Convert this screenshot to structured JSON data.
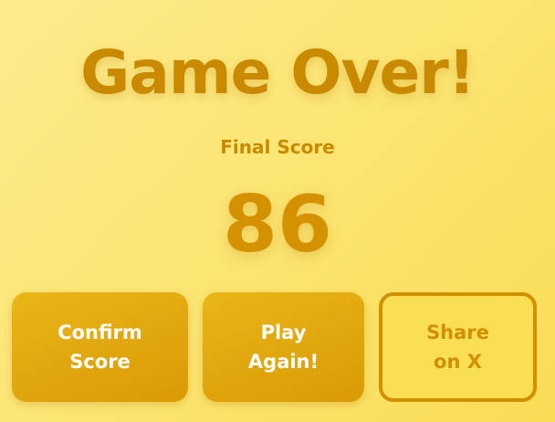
{
  "game_over": {
    "title": "Game Over!",
    "score_label": "Final Score",
    "score_value": "86"
  },
  "actions": {
    "confirm_label": "Confirm\nScore",
    "play_again_label": "Play\nAgain!",
    "share_label": "Share\non X"
  },
  "colors": {
    "accent": "#c98a00",
    "button_fill": "#e0a70d",
    "background": "#fbe46f"
  }
}
